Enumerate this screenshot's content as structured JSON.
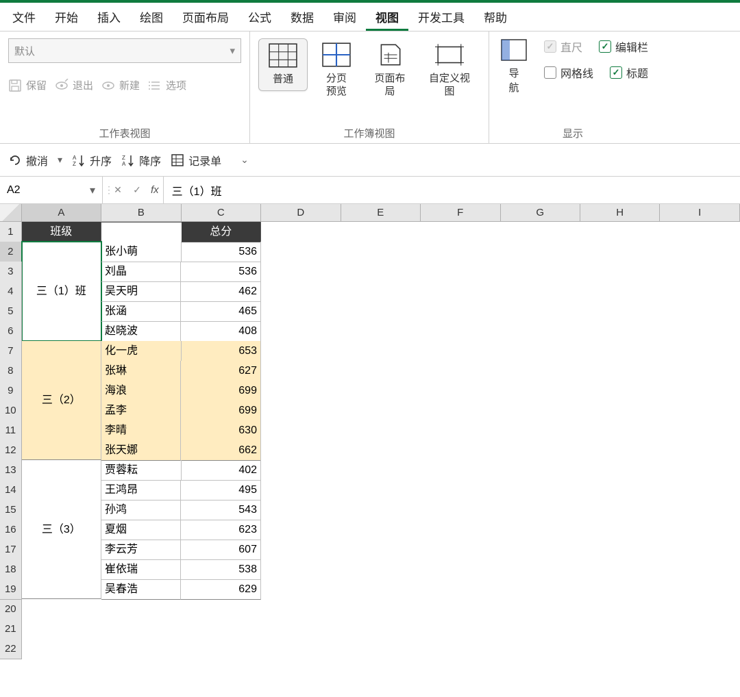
{
  "menu": {
    "file": "文件",
    "home": "开始",
    "insert": "插入",
    "draw": "绘图",
    "layout": "页面布局",
    "formula": "公式",
    "data": "数据",
    "review": "审阅",
    "view": "视图",
    "dev": "开发工具",
    "help": "帮助"
  },
  "ribbon": {
    "sheetViews": {
      "default": "默认",
      "keep": "保留",
      "exit": "退出",
      "new": "新建",
      "options": "选项",
      "group": "工作表视图"
    },
    "workbookViews": {
      "normal": "普通",
      "pageBreak": "分页\n预览",
      "pageLayout": "页面布局",
      "custom": "自定义视图",
      "group": "工作簿视图"
    },
    "show": {
      "nav": "导\n航",
      "ruler": "直尺",
      "formulaBar": "编辑栏",
      "gridlines": "网格线",
      "headings": "标题",
      "group": "显示"
    }
  },
  "qat": {
    "undo": "撤消",
    "asc": "升序",
    "desc": "降序",
    "recordForm": "记录单"
  },
  "formulaBar": {
    "nameBox": "A2",
    "fx": "fx",
    "value": "三（1）班"
  },
  "columns": [
    "A",
    "B",
    "C",
    "D",
    "E",
    "F",
    "G",
    "H",
    "I"
  ],
  "headerRow": {
    "class": "班级",
    "blank": "",
    "total": "总分"
  },
  "groups": [
    {
      "name": "三（1）班",
      "highlight": false,
      "rows": [
        [
          "张小萌",
          536
        ],
        [
          "刘晶",
          536
        ],
        [
          "吴天明",
          462
        ],
        [
          "张涵",
          465
        ],
        [
          "赵晓波",
          408
        ]
      ]
    },
    {
      "name": "三（2）",
      "highlight": true,
      "rows": [
        [
          "化一虎",
          653
        ],
        [
          "张琳",
          627
        ],
        [
          "海浪",
          699
        ],
        [
          "孟李",
          699
        ],
        [
          "李晴",
          630
        ],
        [
          "张天娜",
          662
        ]
      ]
    },
    {
      "name": "三（3）",
      "highlight": false,
      "rows": [
        [
          "贾蓉耘",
          402
        ],
        [
          "王鸿昂",
          495
        ],
        [
          "孙鸿",
          543
        ],
        [
          "夏烟",
          623
        ],
        [
          "李云芳",
          607
        ],
        [
          "崔依瑞",
          538
        ],
        [
          "吴春浩",
          629
        ]
      ]
    }
  ],
  "trailingEmptyRows": 3,
  "selectedCell": {
    "col": "A",
    "row": 2
  }
}
